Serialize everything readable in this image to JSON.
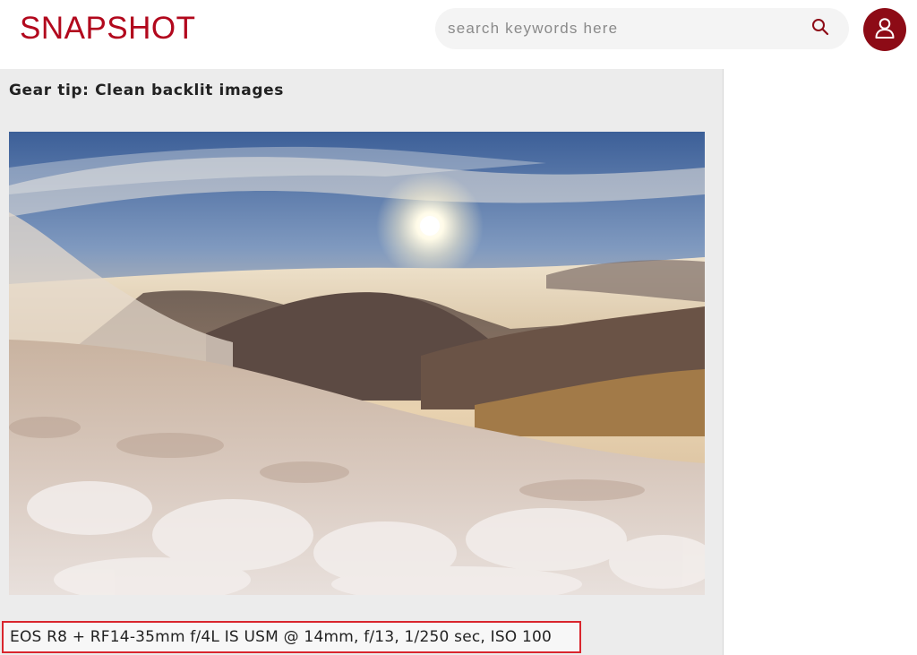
{
  "header": {
    "logo_text": "SNAPSHOT",
    "search": {
      "placeholder": "search keywords here",
      "value": ""
    },
    "icons": {
      "search": "search-icon",
      "avatar": "user-icon"
    }
  },
  "article": {
    "title": "Gear tip: Clean backlit images",
    "photo_alt": "Sunrise over a sea of clouds with frost-covered grass on a mountain slope",
    "caption": "EOS R8 + RF14-35mm f/4L IS USM @ 14mm, f/13, 1/250 sec, ISO 100"
  },
  "colors": {
    "brand": "#b2081d",
    "avatar_bg": "#8d0b16",
    "caption_highlight": "#d9262e",
    "panel_bg": "#ececec"
  }
}
